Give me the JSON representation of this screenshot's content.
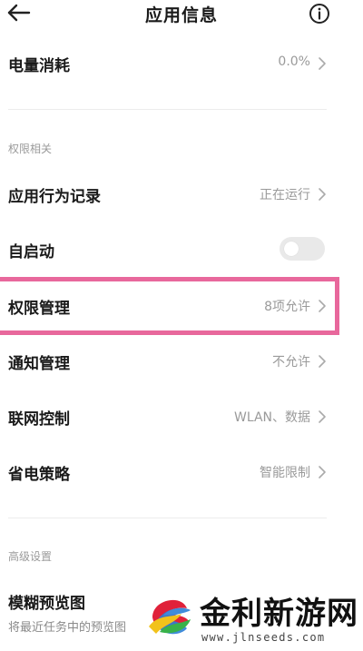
{
  "header": {
    "title": "应用信息",
    "back_icon": "arrow-left-icon",
    "info_icon": "info-circle-icon"
  },
  "battery": {
    "label": "电量消耗",
    "value": "0.0%"
  },
  "permissions_section": {
    "heading": "权限相关",
    "behavior": {
      "label": "应用行为记录",
      "value": "正在运行"
    },
    "autostart": {
      "label": "自启动",
      "enabled": false
    },
    "permission_mgmt": {
      "label": "权限管理",
      "value": "8项允许"
    },
    "notification": {
      "label": "通知管理",
      "value": "不允许"
    },
    "network": {
      "label": "联网控制",
      "value": "WLAN、数据"
    },
    "power_saving": {
      "label": "省电策略",
      "value": "智能限制"
    }
  },
  "advanced_section": {
    "heading": "高级设置",
    "blur_preview": {
      "label": "模糊预览图",
      "description": "将最近任务中的预览图"
    }
  },
  "watermark": {
    "title": "金利新游网",
    "url": "www.jlnseeds.com"
  },
  "colors": {
    "highlight": "#e8689c",
    "secondary_text": "#9a9a9a",
    "primary_text": "#1a1a1a"
  }
}
